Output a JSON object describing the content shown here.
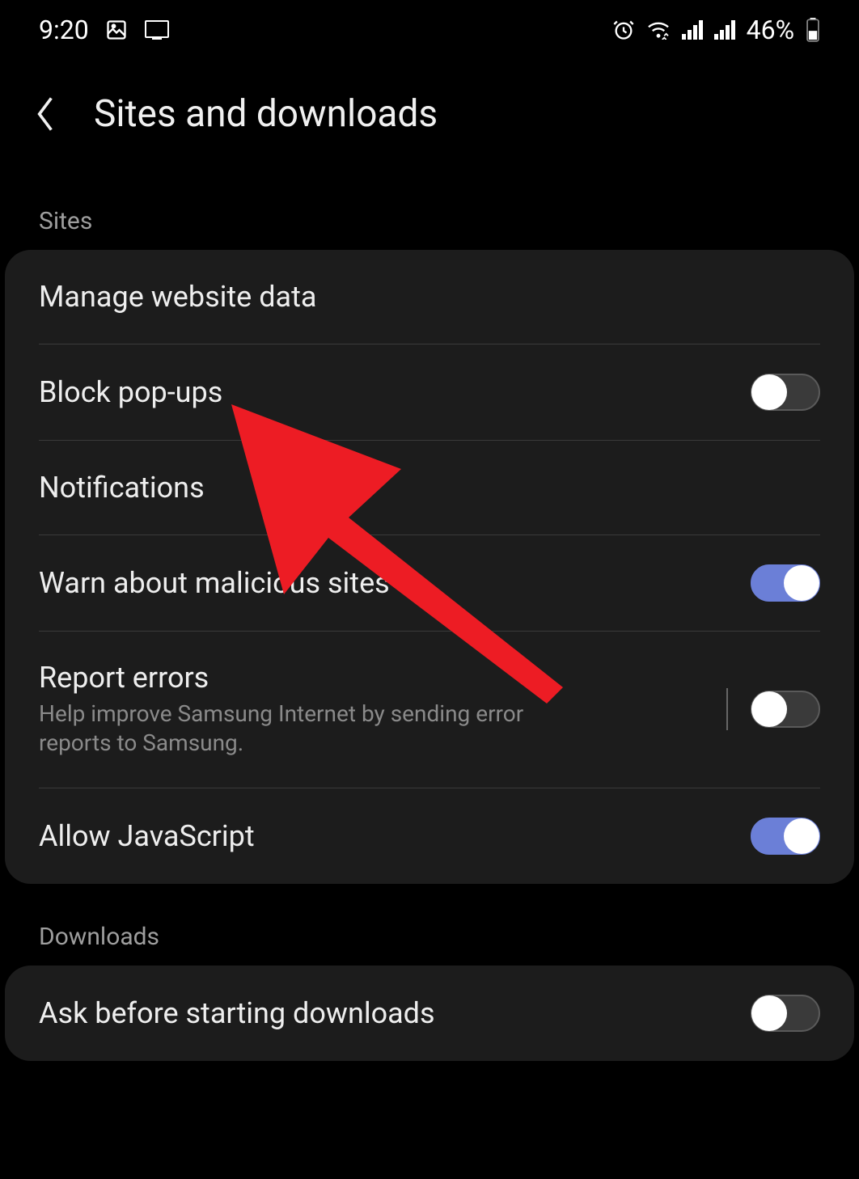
{
  "status_bar": {
    "time": "9:20",
    "battery": "46%"
  },
  "header": {
    "title": "Sites and downloads"
  },
  "sections": {
    "sites_label": "Sites",
    "downloads_label": "Downloads"
  },
  "items": {
    "manage_website_data": "Manage website data",
    "block_popups": "Block pop-ups",
    "notifications": "Notifications",
    "warn_malicious": "Warn about malicious sites",
    "report_errors": "Report errors",
    "report_errors_sub": "Help improve Samsung Internet by sending error reports to Samsung.",
    "allow_javascript": "Allow JavaScript",
    "ask_before_downloads": "Ask before starting downloads"
  },
  "toggles": {
    "block_popups": false,
    "warn_malicious": true,
    "report_errors": false,
    "allow_javascript": true,
    "ask_before_downloads": false
  }
}
